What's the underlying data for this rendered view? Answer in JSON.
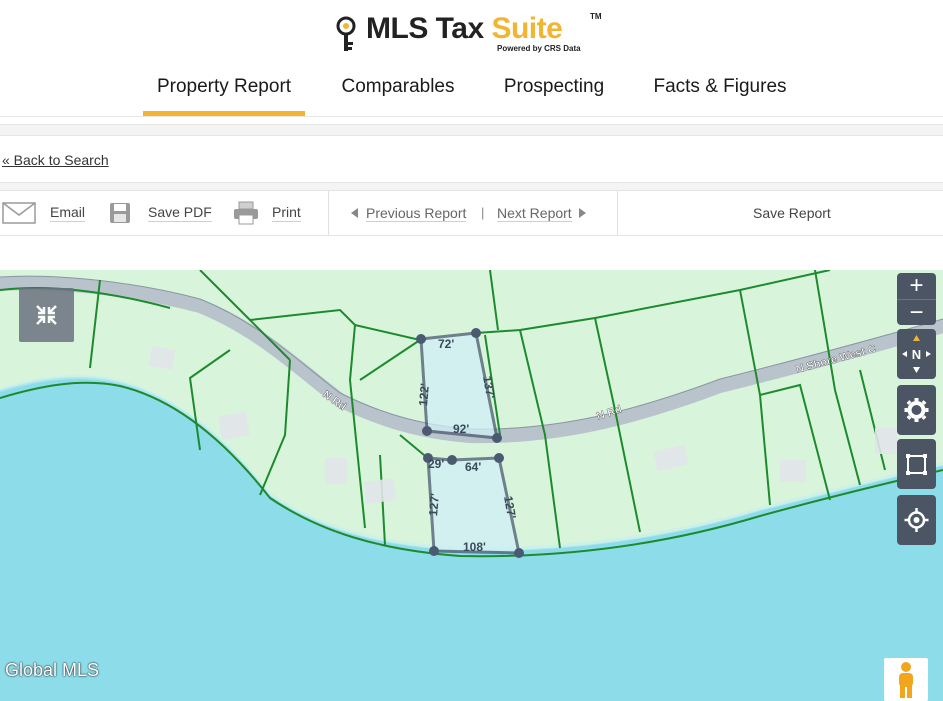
{
  "brand": {
    "name_part1": "MLS Tax ",
    "name_part2": "Suite",
    "trademark": "TM",
    "powered_by": "Powered by CRS Data",
    "accent_color": "#f2b532"
  },
  "main_nav": {
    "tabs": [
      {
        "label": "Property Report",
        "active": true
      },
      {
        "label": "Comparables",
        "active": false
      },
      {
        "label": "Prospecting",
        "active": false
      },
      {
        "label": "Facts & Figures",
        "active": false
      }
    ]
  },
  "back_link": "« Back to Search",
  "toolbar": {
    "email_label": "Email",
    "save_pdf_label": "Save PDF",
    "print_label": "Print",
    "previous_label": "Previous Report",
    "separator": "|",
    "next_label": "Next Report",
    "save_report_label": "Save Report"
  },
  "map": {
    "watermark": "Global MLS",
    "streets": [
      "N Rd",
      "N Rd",
      "N Shore West C"
    ],
    "lot_dimensions": {
      "upper_lot": [
        "72'",
        "122'",
        "137'",
        "92'"
      ],
      "lower_lot": [
        "29'",
        "64'",
        "127'",
        "127'",
        "108'"
      ]
    },
    "icons": [
      "collapse-icon",
      "zoom-in-icon",
      "zoom-out-icon",
      "compass-icon",
      "gear-icon",
      "measure-icon",
      "locate-icon",
      "pegman-icon"
    ],
    "compass_label": "N",
    "zoom_in_symbol": "+",
    "zoom_out_symbol": "−",
    "colors": {
      "water": "#8ddcea",
      "land": "#d8f5dc",
      "parcel_line": "#1e8a2e",
      "road": "#b9c3cc",
      "selected_parcel": "#4a5a70"
    }
  }
}
